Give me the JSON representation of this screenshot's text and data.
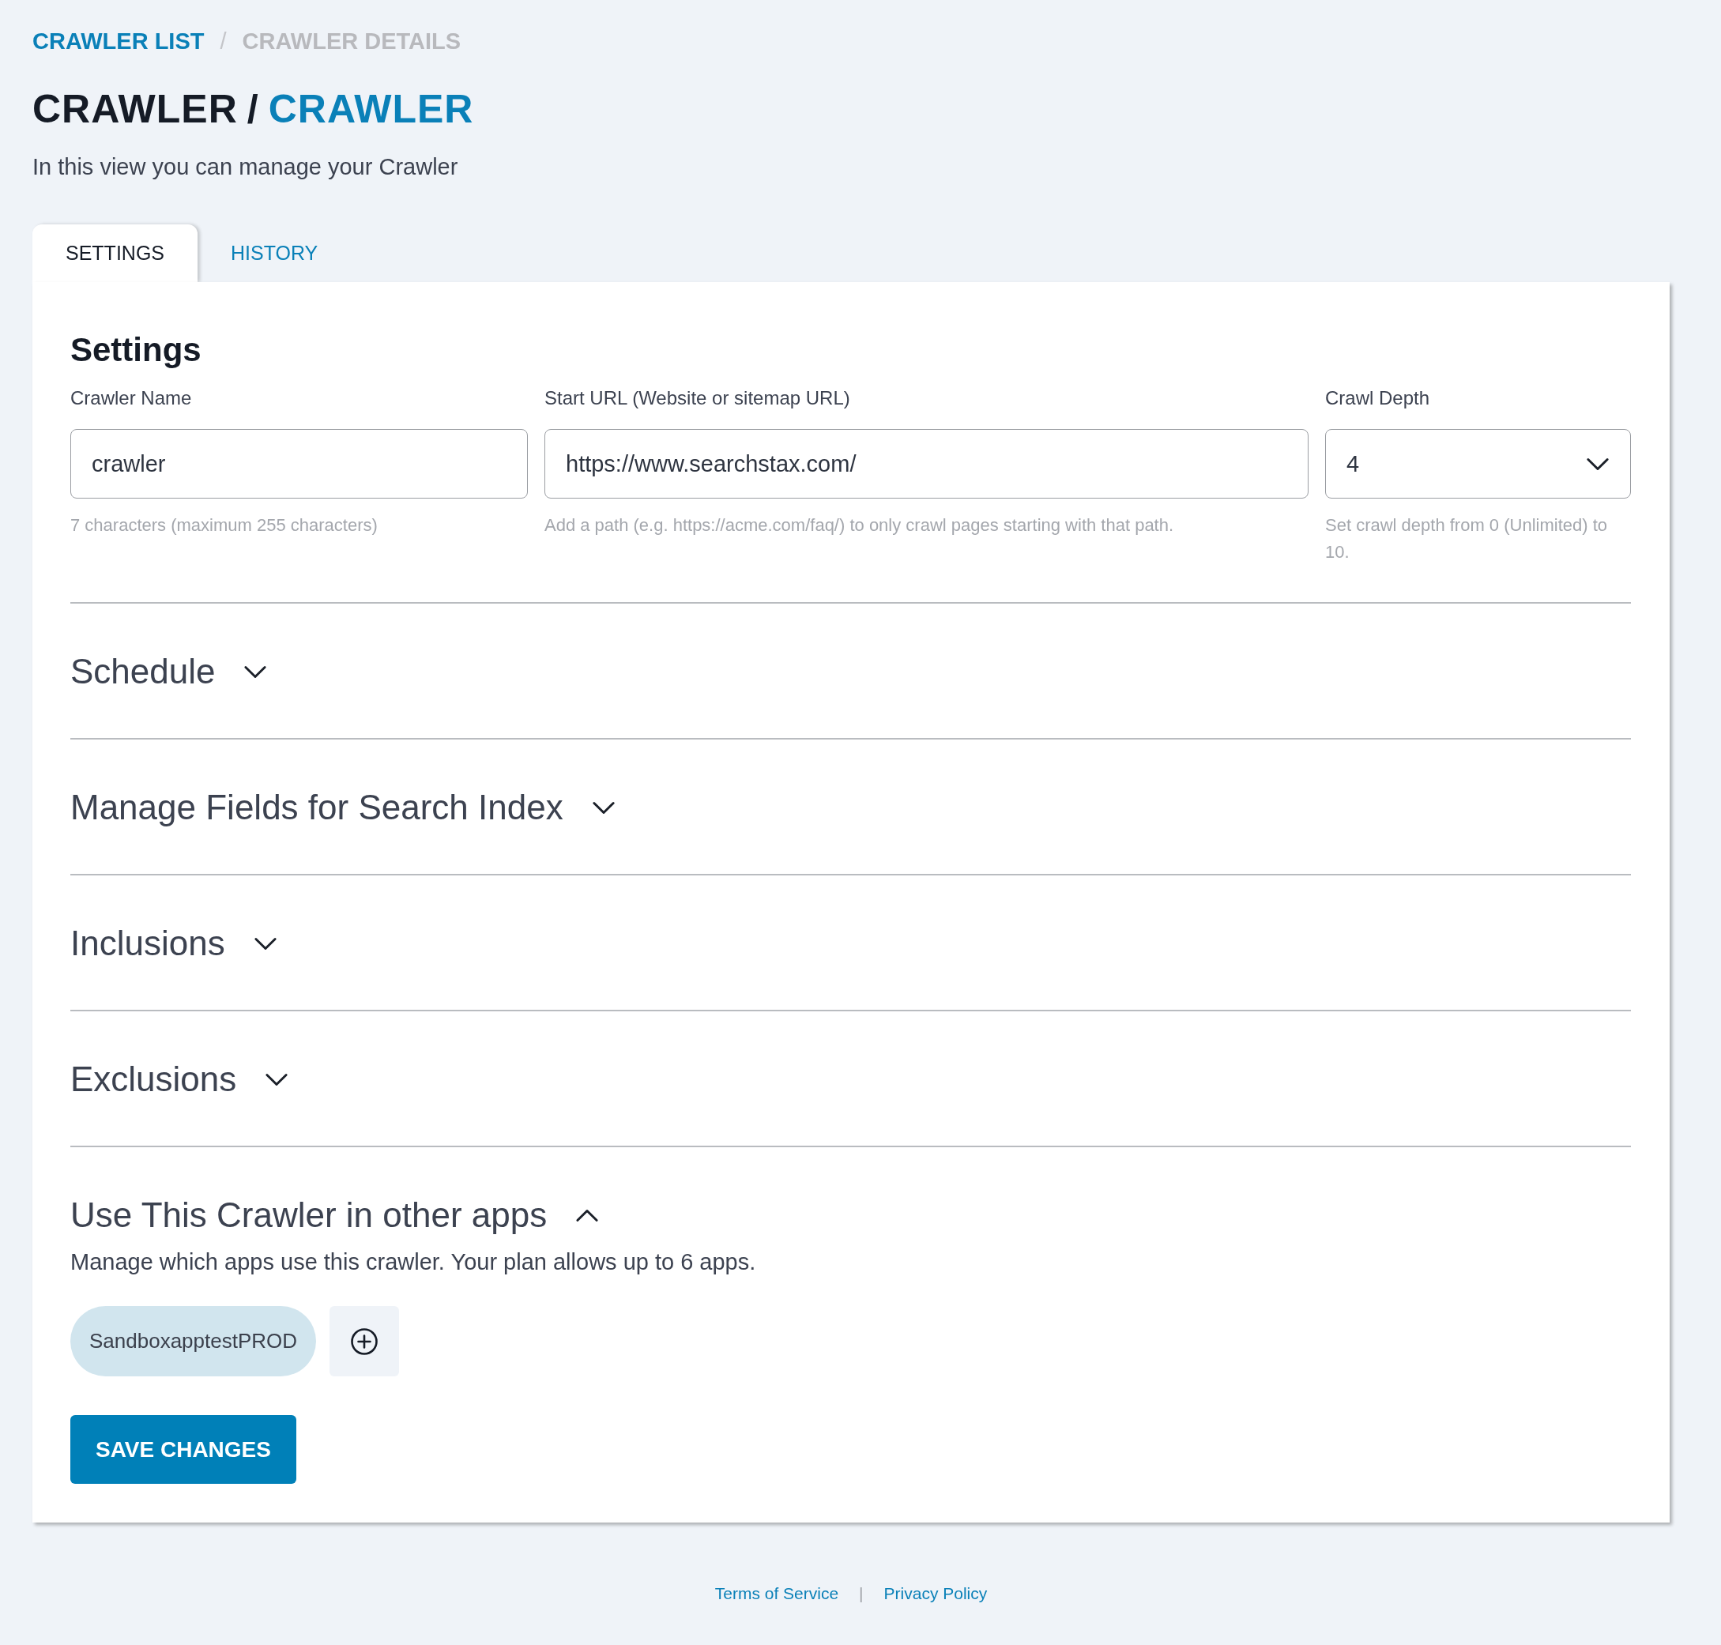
{
  "breadcrumb": [
    {
      "label": "CRAWLER LIST",
      "kind": "link"
    },
    {
      "label": "CRAWLER DETAILS",
      "kind": "current"
    }
  ],
  "breadcrumb_separator": "/",
  "title": {
    "prefix": "CRAWLER",
    "separator": "/",
    "name": "CRAWLER"
  },
  "subtitle": "In this view you can manage your Crawler",
  "tabs": [
    {
      "label": "SETTINGS",
      "selected": true
    },
    {
      "label": "HISTORY",
      "selected": false
    }
  ],
  "settings": {
    "heading": "Settings",
    "fields": [
      {
        "kind": "text",
        "label": "Crawler Name",
        "value": "crawler",
        "hint": "7 characters (maximum 255 characters)"
      },
      {
        "kind": "text",
        "label": "Start URL (Website or sitemap URL)",
        "value": "https://www.searchstax.com/",
        "hint": "Add a path (e.g. https://acme.com/faq/) to only crawl pages starting with that path."
      },
      {
        "kind": "select",
        "label": "Crawl Depth",
        "value": "4",
        "hint": "Set crawl depth from 0 (Unlimited) to 10."
      }
    ]
  },
  "sections": [
    {
      "title": "Schedule",
      "expanded": false
    },
    {
      "title": "Manage Fields for Search Index",
      "expanded": false
    },
    {
      "title": "Inclusions",
      "expanded": false
    },
    {
      "title": "Exclusions",
      "expanded": false
    },
    {
      "title": "Use This Crawler in other apps",
      "expanded": true,
      "description": "Manage which apps use this crawler. Your plan allows up to 6 apps.",
      "apps": [
        "SandboxapptestPROD"
      ]
    }
  ],
  "save_button": "SAVE CHANGES",
  "footer": {
    "links": [
      "Terms of Service",
      "Privacy Policy"
    ],
    "separator": "|"
  }
}
